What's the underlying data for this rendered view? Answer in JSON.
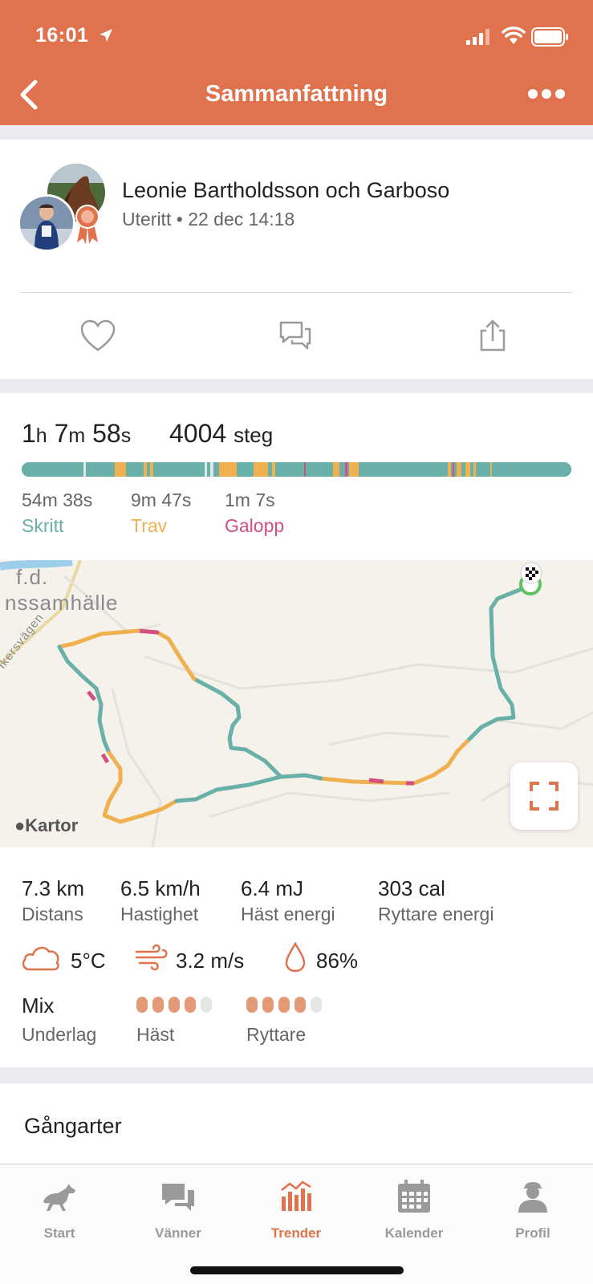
{
  "status_bar": {
    "time": "16:01"
  },
  "header": {
    "title": "Sammanfattning"
  },
  "post": {
    "name": "Leonie Bartholdsson och Garboso",
    "type": "Uteritt",
    "separator": "•",
    "date": "22 dec 14:18"
  },
  "summary": {
    "duration_h": "1",
    "duration_h_unit": "h",
    "duration_m": "7",
    "duration_m_unit": "m",
    "duration_s": "58",
    "duration_s_unit": "s",
    "steps_value": "4004",
    "steps_unit": "steg",
    "gaits": [
      {
        "time": "54m 38s",
        "label": "Skritt",
        "color": "#68b0a8"
      },
      {
        "time": "9m 47s",
        "label": "Trav",
        "color": "#f0b050"
      },
      {
        "time": "1m 7s",
        "label": "Galopp",
        "color": "#d24f7f"
      }
    ]
  },
  "map": {
    "place_line1": "f.d.",
    "place_line2": "nssamhälle",
    "road": "ikersvägen",
    "attribution": "Kartor"
  },
  "stats": [
    {
      "value": "7.3 km",
      "label": "Distans"
    },
    {
      "value": "6.5 km/h",
      "label": "Hastighet"
    },
    {
      "value": "6.4 mJ",
      "label": "Häst energi"
    },
    {
      "value": "303 cal",
      "label": "Ryttare energi"
    }
  ],
  "weather": {
    "temperature": "5°C",
    "wind": "3.2 m/s",
    "humidity": "86%"
  },
  "ground": {
    "value": "Mix",
    "label": "Underlag",
    "horse_label": "Häst",
    "horse_rating": 4,
    "rider_label": "Ryttare",
    "rider_rating": 4,
    "rating_max": 5
  },
  "gaits_section": {
    "title": "Gångarter"
  },
  "tabs": [
    {
      "label": "Start",
      "icon": "horse-icon"
    },
    {
      "label": "Vänner",
      "icon": "chat-bubbles-icon"
    },
    {
      "label": "Trender",
      "icon": "bar-chart-icon",
      "active": true
    },
    {
      "label": "Kalender",
      "icon": "calendar-icon"
    },
    {
      "label": "Profil",
      "icon": "person-icon"
    }
  ],
  "colors": {
    "accent": "#e0734d",
    "walk": "#68b0a8",
    "trot": "#f0b050",
    "canter": "#d24f7f"
  }
}
